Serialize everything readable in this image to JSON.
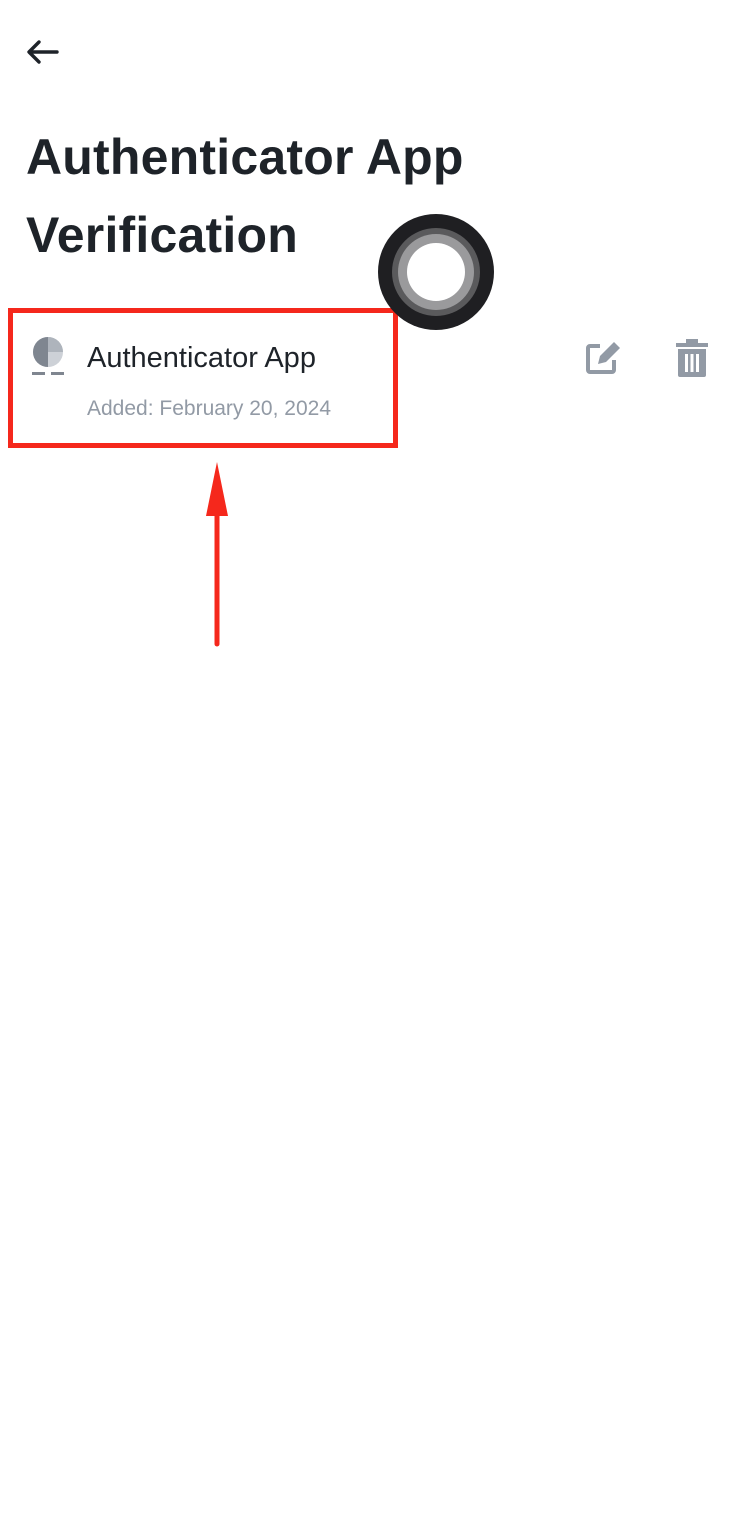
{
  "header": {
    "back_icon": "arrow-left-icon",
    "title": "Authenticator App Verification"
  },
  "method": {
    "icon": "authenticator-app-icon",
    "name": "Authenticator App",
    "added": "Added: February 20, 2024",
    "edit_icon": "edit-icon",
    "delete_icon": "trash-icon"
  },
  "colors": {
    "title_text": "#1e2329",
    "secondary_text": "#929aa5",
    "icon_gray": "#929aa5",
    "annotation_red": "#f5281c"
  }
}
